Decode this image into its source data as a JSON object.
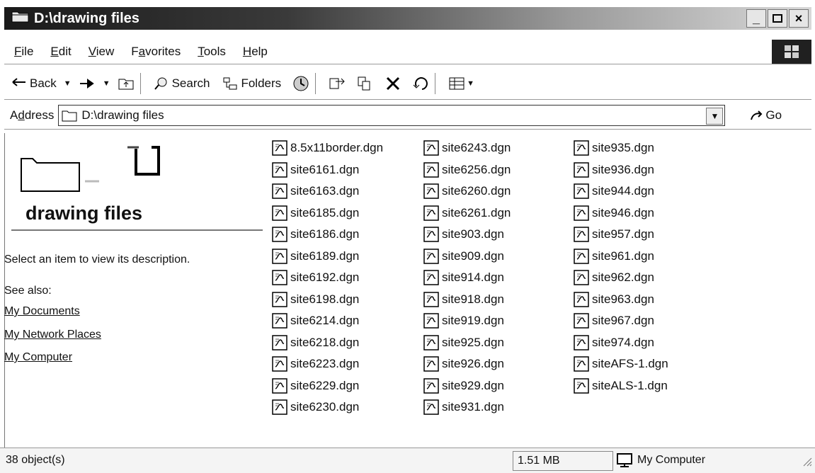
{
  "window": {
    "title": "D:\\drawing files"
  },
  "menu": [
    {
      "accel": "F",
      "rest": "ile"
    },
    {
      "accel": "E",
      "rest": "dit"
    },
    {
      "accel": "V",
      "rest": "iew"
    },
    {
      "pre": "F",
      "accel": "a",
      "rest": "vorites"
    },
    {
      "accel": "T",
      "rest": "ools"
    },
    {
      "accel": "H",
      "rest": "elp"
    }
  ],
  "toolbar": {
    "back": "Back",
    "search": "Search",
    "folders": "Folders"
  },
  "address": {
    "label_pre": "A",
    "label_accel": "d",
    "label_rest": "dress",
    "value": "D:\\drawing files",
    "go": "Go"
  },
  "left_pane": {
    "title": "drawing files",
    "description": "Select an item to view its description.",
    "see_also": "See also:",
    "links": [
      "My Documents",
      "My Network Places",
      "My Computer"
    ]
  },
  "files": {
    "col1": [
      "8.5x11border.dgn",
      "site6161.dgn",
      "site6163.dgn",
      "site6185.dgn",
      "site6186.dgn",
      "site6189.dgn",
      "site6192.dgn",
      "site6198.dgn",
      "site6214.dgn",
      "site6218.dgn",
      "site6223.dgn",
      "site6229.dgn",
      "site6230.dgn"
    ],
    "col2": [
      "site6243.dgn",
      "site6256.dgn",
      "site6260.dgn",
      "site6261.dgn",
      "site903.dgn",
      "site909.dgn",
      "site914.dgn",
      "site918.dgn",
      "site919.dgn",
      "site925.dgn",
      "site926.dgn",
      "site929.dgn",
      "site931.dgn"
    ],
    "col3": [
      "site935.dgn",
      "site936.dgn",
      "site944.dgn",
      "site946.dgn",
      "site957.dgn",
      "site961.dgn",
      "site962.dgn",
      "site963.dgn",
      "site967.dgn",
      "site974.dgn",
      "siteAFS-1.dgn",
      "siteALS-1.dgn"
    ]
  },
  "status": {
    "objects": "38 object(s)",
    "size": "1.51 MB",
    "zone": "My Computer"
  }
}
